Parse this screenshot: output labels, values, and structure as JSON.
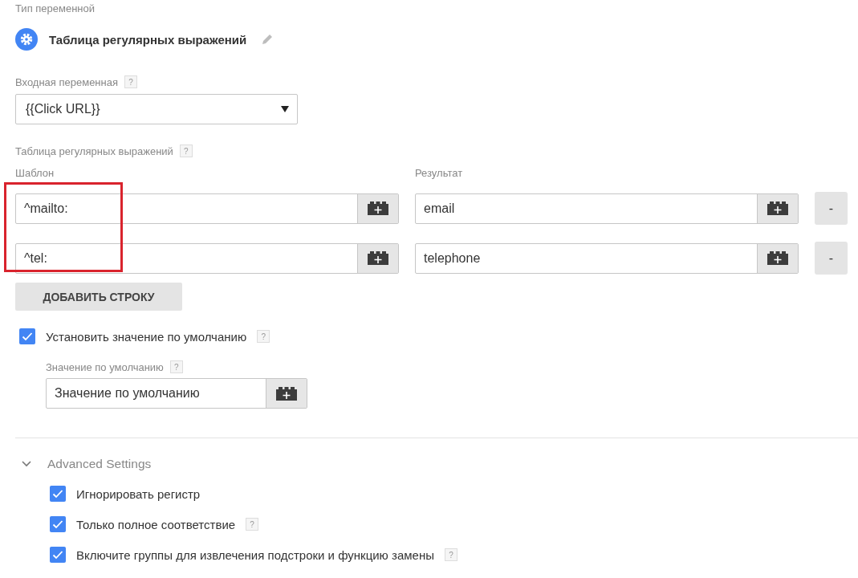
{
  "variable_type": {
    "label": "Тип переменной",
    "name": "Таблица регулярных выражений"
  },
  "input_variable": {
    "label": "Входная переменная",
    "help": "?",
    "value": "{{Click URL}}"
  },
  "regex_table": {
    "label": "Таблица регулярных выражений",
    "help": "?",
    "columns": [
      "Шаблон",
      "Результат"
    ],
    "pattern_column_highlighted": true,
    "rows": [
      {
        "pattern": "^mailto:",
        "result": "email",
        "remove": "-"
      },
      {
        "pattern": "^tel:",
        "result": "telephone",
        "remove": "-"
      }
    ],
    "add_button": "ДОБАВИТЬ СТРОКУ"
  },
  "default_value": {
    "label": "Установить значение по умолчанию",
    "help": "?",
    "checked": true,
    "field_label": "Значение по умолчанию",
    "field_help": "?",
    "value": "Значение по умолчанию"
  },
  "advanced": {
    "title": "Advanced Settings",
    "expanded": true,
    "options": [
      {
        "label": "Игнорировать регистр",
        "checked": true
      },
      {
        "label": "Только полное соответствие",
        "help": "?",
        "checked": true
      },
      {
        "label": "Включите группы для извлечения подстроки и функцию замены",
        "help": "?",
        "checked": true
      }
    ]
  }
}
